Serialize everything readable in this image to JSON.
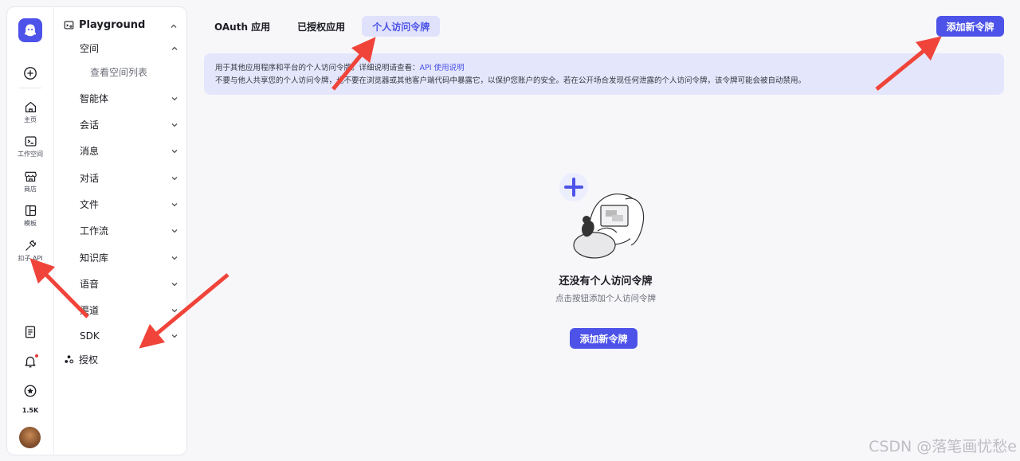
{
  "rail": {
    "items": [
      {
        "label": "主页",
        "icon": "home-icon"
      },
      {
        "label": "工作空间",
        "icon": "terminal-icon"
      },
      {
        "label": "商店",
        "icon": "store-icon"
      },
      {
        "label": "模板",
        "icon": "template-icon"
      },
      {
        "label": "扣子 API",
        "icon": "plug-icon"
      }
    ],
    "stars": "1.5K"
  },
  "nav": {
    "head": "Playground",
    "space": "空间",
    "space_sub": "查看空间列表",
    "items": [
      "智能体",
      "会话",
      "消息",
      "对话",
      "文件",
      "工作流",
      "知识库",
      "语音",
      "渠道",
      "SDK"
    ],
    "auth": "授权"
  },
  "tabs": [
    {
      "label": "OAuth 应用",
      "active": false
    },
    {
      "label": "已授权应用",
      "active": false
    },
    {
      "label": "个人访问令牌",
      "active": true
    }
  ],
  "add_button": "添加新令牌",
  "notice": {
    "line1_prefix": "用于其他应用程序和平台的个人访问令牌。详细说明请查看：",
    "line1_link": "API 使用说明",
    "line2": "不要与他人共享您的个人访问令牌，也不要在浏览器或其他客户端代码中暴露它，以保护您账户的安全。若在公开场合发现任何泄露的个人访问令牌，该令牌可能会被自动禁用。"
  },
  "empty": {
    "title": "还没有个人访问令牌",
    "desc": "点击按钮添加个人访问令牌",
    "button": "添加新令牌"
  },
  "watermark": "CSDN @落笔画忧愁e",
  "colors": {
    "accent": "#4d53e8",
    "arrow": "#f0443a"
  }
}
